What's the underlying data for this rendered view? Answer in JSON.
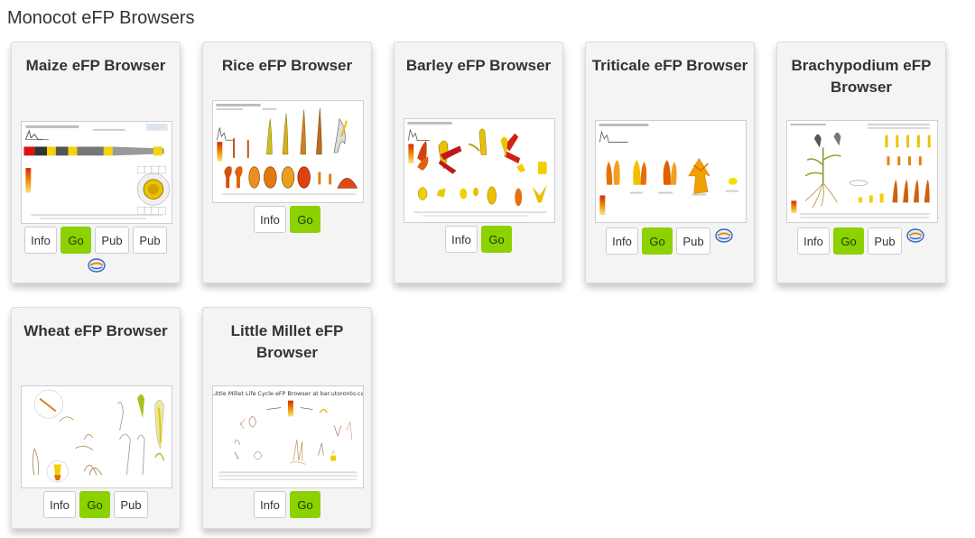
{
  "page": {
    "title": "Monocot eFP Browsers"
  },
  "buttons": {
    "info": "Info",
    "go": "Go",
    "pub": "Pub"
  },
  "cards": [
    {
      "id": "maize",
      "title": "Maize eFP Browser"
    },
    {
      "id": "rice",
      "title": "Rice eFP Browser"
    },
    {
      "id": "barley",
      "title": "Barley eFP Browser"
    },
    {
      "id": "triticale",
      "title": "Triticale eFP Browser"
    },
    {
      "id": "brachypodium",
      "title": "Brachypodium eFP Browser"
    },
    {
      "id": "wheat",
      "title": "Wheat eFP Browser"
    },
    {
      "id": "little-millet",
      "title": "Little Millet eFP Browser"
    }
  ],
  "thumbnails": {
    "little_millet_heading": "Little Millet Life Cycle eFP Browser at bar.utoronto.ca"
  },
  "colors": {
    "go_button": "#8cd100",
    "card_bg": "#f4f4f4",
    "efp_red": "#d42a10",
    "efp_orange": "#f08a00",
    "efp_yellow": "#f5d400"
  },
  "icons": {
    "external_link": "ensembl-icon"
  }
}
